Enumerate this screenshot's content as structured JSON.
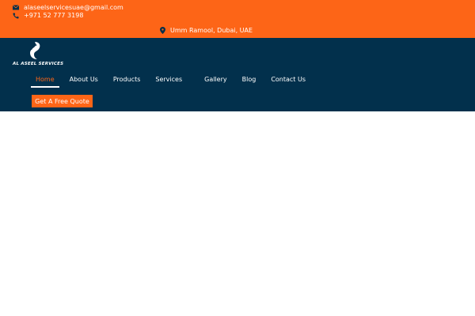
{
  "topbar": {
    "email": "alaseelservicesuae@gmail.com",
    "phone": "+971 52 777 3198",
    "address": "Umm Ramool, Dubai, UAE"
  },
  "logo": {
    "text": "AL ASEEL SERVICES"
  },
  "nav": {
    "items": [
      {
        "label": "Home",
        "active": true
      },
      {
        "label": "About Us"
      },
      {
        "label": "Products"
      },
      {
        "label": "Services"
      },
      {
        "label": "Gallery"
      },
      {
        "label": "Blog"
      },
      {
        "label": "Contact Us"
      }
    ]
  },
  "cta": {
    "label": "Get A Free Quote"
  },
  "colors": {
    "accent": "#fd6517",
    "navbar": "#02304c"
  }
}
